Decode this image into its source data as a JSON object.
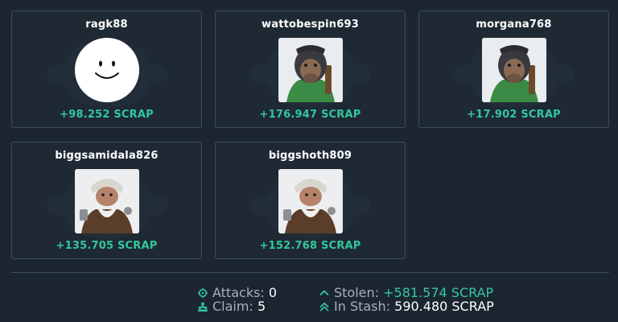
{
  "accent_color": "#33c79e",
  "cards": [
    {
      "name": "ragk88",
      "amount": "+98.252 SCRAP",
      "avatar": "smiley-face"
    },
    {
      "name": "wattobespin693",
      "amount": "+176.947 SCRAP",
      "avatar": "ape-portrait"
    },
    {
      "name": "morgana768",
      "amount": "+17.902 SCRAP",
      "avatar": "ape-portrait"
    },
    {
      "name": "biggsamidala826",
      "amount": "+135.705 SCRAP",
      "avatar": "gnome-portrait"
    },
    {
      "name": "biggshoth809",
      "amount": "+152.768 SCRAP",
      "avatar": "gnome-portrait"
    }
  ],
  "stats": {
    "attacks": {
      "label": "Attacks:",
      "value": "0",
      "icon": "crosshair-icon"
    },
    "claim": {
      "label": "Claim:",
      "value": "5",
      "icon": "users-icon"
    },
    "stolen": {
      "label": "Stolen:",
      "value": "+581.574 SCRAP",
      "icon": "chevron-up-icon"
    },
    "stash": {
      "label": "In Stash:",
      "value": "590.480 SCRAP",
      "icon": "double-chevron-up-icon"
    }
  }
}
